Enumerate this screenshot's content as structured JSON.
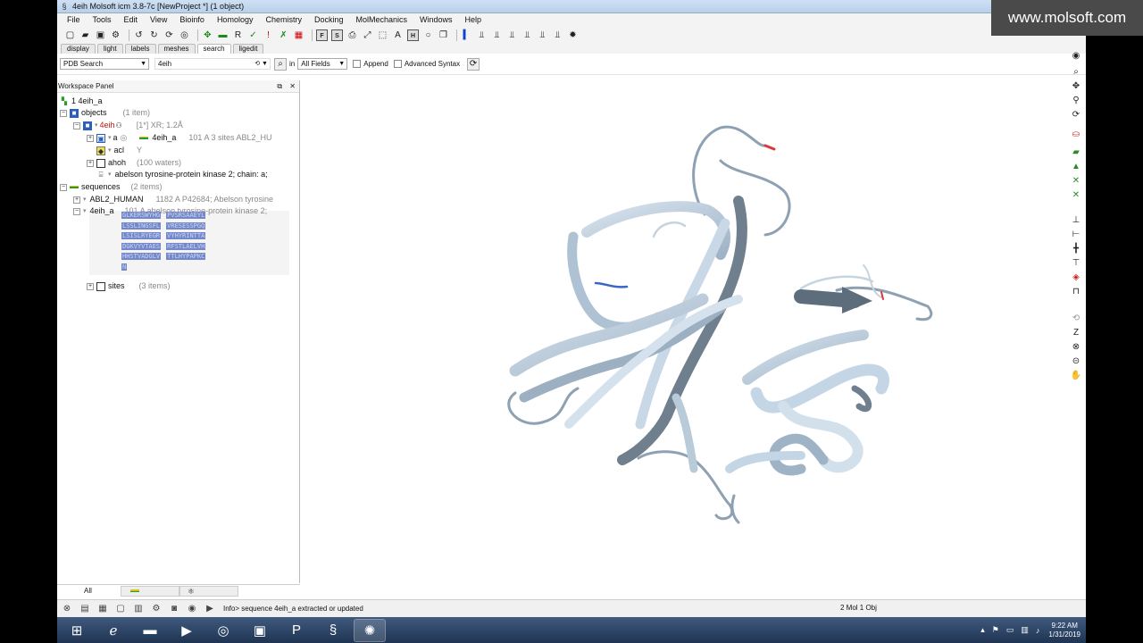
{
  "window": {
    "title": "4eih Molsoft icm 3.8-7c  [NewProject *] (1 object)",
    "watermark": "www.molsoft.com"
  },
  "menu": [
    "File",
    "Tools",
    "Edit",
    "View",
    "Bioinfo",
    "Homology",
    "Chemistry",
    "Docking",
    "MolMechanics",
    "Windows",
    "Help"
  ],
  "tabs": [
    "display",
    "light",
    "labels",
    "meshes",
    "search",
    "ligedit"
  ],
  "active_tab": "search",
  "search": {
    "source": "PDB Search",
    "query": "4eih",
    "in_label": "in",
    "field": "All Fields",
    "append_label": "Append",
    "advanced_label": "Advanced Syntax"
  },
  "workspace": {
    "title": "Workspace Panel",
    "root": "1 4eih_a",
    "objects_label": "objects",
    "objects_count": "(1 item)",
    "object_name": "4eih",
    "object_info": "[1*]  XR; 1.2Å",
    "chain_a": "a",
    "chain_a_name": "4eih_a",
    "chain_a_info": "101 A  3 sites ABL2_HU",
    "acl_label": "acl",
    "acl_info": "Y",
    "ahoh_label": "ahoh",
    "ahoh_info": "(100 waters)",
    "protein_label": "abelson tyrosine-protein kinase 2; chain: a;",
    "sequences_label": "sequences",
    "sequences_count": "(2 items)",
    "seq1_name": "ABL2_HUMAN",
    "seq1_info": "1182 A P42684; Abelson tyrosine",
    "seq2_name": "4eih_a",
    "seq2_info": "101 A abelson tyrosine-protein kinase 2;",
    "seq_lines": [
      [
        "GLKERSWYHG",
        "PVSRSAAEYL"
      ],
      [
        "LSSLINGSFL",
        "VRESESSPGQ"
      ],
      [
        "LSISLRYEGR",
        "VYHYRINTTA"
      ],
      [
        "DGKVYVTAES",
        "RFSTLAELVH"
      ],
      [
        "HHSTVADGLV",
        "TTLHYPAPKC"
      ],
      [
        "N",
        ""
      ]
    ],
    "sites_label": "sites",
    "sites_count": "(3 items)",
    "footer_tab": "All"
  },
  "status": {
    "message": "Info> sequence 4eih_a extracted or updated",
    "right": "2 Mol 1 Obj"
  },
  "clock": {
    "time": "9:22 AM",
    "date": "1/31/2019"
  },
  "colors": {
    "ribbon_light": "#c4d6e6",
    "ribbon_dark": "#7c8c9a",
    "selection": "#7488c9"
  }
}
